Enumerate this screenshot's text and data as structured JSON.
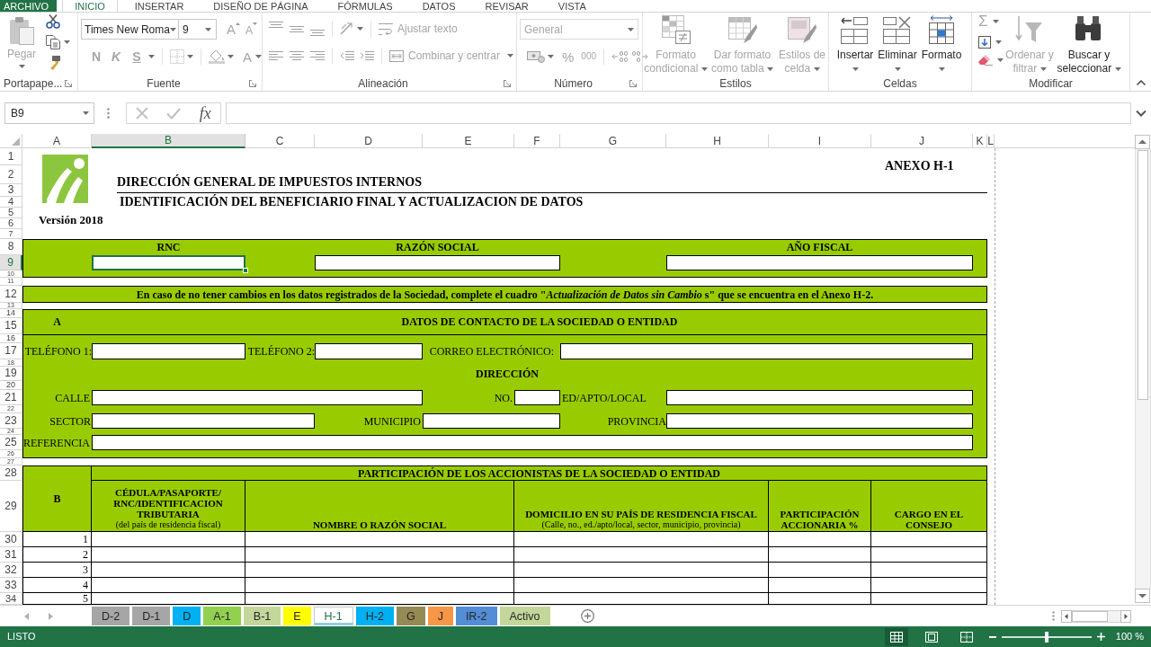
{
  "ribbon_tabs": [
    {
      "label": "ARCHIVO",
      "kind": "file",
      "selected": false
    },
    {
      "label": "INICIO",
      "kind": "tab",
      "selected": true
    },
    {
      "label": "INSERTAR",
      "kind": "tab",
      "selected": false
    },
    {
      "label": "DISEÑO DE PÁGINA",
      "kind": "tab",
      "selected": false
    },
    {
      "label": "FÓRMULAS",
      "kind": "tab",
      "selected": false
    },
    {
      "label": "DATOS",
      "kind": "tab",
      "selected": false
    },
    {
      "label": "REVISAR",
      "kind": "tab",
      "selected": false
    },
    {
      "label": "VISTA",
      "kind": "tab",
      "selected": false
    }
  ],
  "ribbon": {
    "clipboard": {
      "label": "Portapape...",
      "paste": {
        "label": "Pegar",
        "disabled": true
      }
    },
    "font": {
      "label": "Fuente",
      "font_name": "Times New Roma",
      "font_size": "9",
      "grow": {
        "label": "A",
        "disabled": true
      },
      "shrink": {
        "label": "A",
        "disabled": true
      },
      "bold": {
        "label": "N",
        "disabled": true
      },
      "italic": {
        "label": "K",
        "disabled": true
      },
      "underline": {
        "label": "S",
        "disabled": true
      },
      "font_color": {
        "label": "A",
        "disabled": true
      }
    },
    "alignment": {
      "label": "Alineación",
      "wrap_text": {
        "label": "Ajustar texto",
        "disabled": true
      },
      "merge": {
        "label": "Combinar y centrar",
        "disabled": true
      }
    },
    "number": {
      "label": "Número",
      "format": {
        "value": "General",
        "disabled": true
      },
      "percent": {
        "label": "%",
        "disabled": true
      },
      "thousands": {
        "label": "000",
        "disabled": true
      }
    },
    "styles": {
      "label": "Estilos",
      "buttons": [
        {
          "label": "Formato condicional",
          "disabled": true
        },
        {
          "label": "Dar formato como tabla",
          "disabled": true
        },
        {
          "label": "Estilos de celda",
          "disabled": true
        }
      ]
    },
    "cells": {
      "label": "Celdas",
      "buttons": [
        {
          "label": "Insertar",
          "disabled": false
        },
        {
          "label": "Eliminar",
          "disabled": false
        },
        {
          "label": "Formato",
          "disabled": false
        }
      ]
    },
    "editing": {
      "label": "Modificar",
      "autosum": {
        "label": "Σ",
        "disabled": true
      },
      "buttons": [
        {
          "label": "Ordenar y filtrar",
          "disabled": true
        },
        {
          "label": "Buscar y seleccionar",
          "disabled": false
        }
      ]
    }
  },
  "formula_bar": {
    "name_box": "B9",
    "function_label": "fx"
  },
  "sheet": {
    "columns": [
      {
        "label": "A",
        "selected": false
      },
      {
        "label": "B",
        "selected": true
      },
      {
        "label": "C",
        "selected": false
      },
      {
        "label": "D",
        "selected": false
      },
      {
        "label": "E",
        "selected": false
      },
      {
        "label": "F",
        "selected": false
      },
      {
        "label": "G",
        "selected": false
      },
      {
        "label": "H",
        "selected": false
      },
      {
        "label": "I",
        "selected": false
      },
      {
        "label": "J",
        "selected": false
      },
      {
        "label": "K",
        "selected": false
      },
      {
        "label": "L",
        "selected": false
      }
    ],
    "rows": [
      {
        "label": "1",
        "selected": false
      },
      {
        "label": "2",
        "selected": false
      },
      {
        "label": "3",
        "selected": false
      },
      {
        "label": "4",
        "selected": false
      },
      {
        "label": "5",
        "selected": false
      },
      {
        "label": "6",
        "selected": false
      },
      {
        "label": "7",
        "selected": false
      },
      {
        "label": "8",
        "selected": false
      },
      {
        "label": "9",
        "selected": true
      },
      {
        "label": "10",
        "selected": false
      },
      {
        "label": "11",
        "selected": false
      },
      {
        "label": "12",
        "selected": false
      },
      {
        "label": "13",
        "selected": false
      },
      {
        "label": "14",
        "selected": false
      },
      {
        "label": "15",
        "selected": false
      },
      {
        "label": "16",
        "selected": false
      },
      {
        "label": "17",
        "selected": false
      },
      {
        "label": "18",
        "selected": false
      },
      {
        "label": "19",
        "selected": false
      },
      {
        "label": "20",
        "selected": false
      },
      {
        "label": "21",
        "selected": false
      },
      {
        "label": "22",
        "selected": false
      },
      {
        "label": "23",
        "selected": false
      },
      {
        "label": "24",
        "selected": false
      },
      {
        "label": "25",
        "selected": false
      },
      {
        "label": "26",
        "selected": false
      },
      {
        "label": "27",
        "selected": false
      },
      {
        "label": "28",
        "selected": false
      },
      {
        "label": "29",
        "selected": false
      },
      {
        "label": "30",
        "selected": false
      },
      {
        "label": "31",
        "selected": false
      },
      {
        "label": "32",
        "selected": false
      },
      {
        "label": "33",
        "selected": false
      },
      {
        "label": "34",
        "selected": false
      }
    ],
    "annex": "ANEXO H-1",
    "title": "DIRECCIÓN GENERAL DE IMPUESTOS INTERNOS",
    "subtitle": "IDENTIFICACIÓN DEL BENEFICIARIO FINAL Y ACTUALIZACION DE DATOS",
    "version": "Versión 2018",
    "header_fields": [
      {
        "label": "RNC",
        "selected": true
      },
      {
        "label": "RAZÓN SOCIAL",
        "selected": false
      },
      {
        "label": "AÑO FISCAL",
        "selected": false
      }
    ],
    "notice": "En caso de no tener cambios en los datos registrados de la Sociedad, complete el cuadro \"*Actualización de Datos sin Cambio* s\" que se encuentra en el Anexo H-2.",
    "contact": {
      "letter": "A",
      "title": "DATOS DE CONTACTO DE LA SOCIEDAD O ENTIDAD",
      "address_title": "DIRECCIÓN",
      "fields": [
        "TELÉFONO 1:",
        "TELÉFONO 2:",
        "CORREO ELECTRÓNICO:",
        "CALLE",
        "NO.",
        "ED/APTO/LOCAL",
        "SECTOR",
        "MUNICIPIO",
        "PROVINCIA",
        "REFERENCIA"
      ]
    },
    "shareholders": {
      "letter": "B",
      "title": "PARTICIPACIÓN DE LOS ACCIONISTAS DE LA SOCIEDAD O ENTIDAD",
      "columns": [
        {
          "label": "CÉDULA/PASAPORTE/ RNC/IDENTIFICACION TRIBUTARIA",
          "note": "(del país de residencia fiscal)"
        },
        {
          "label": "NOMBRE O RAZÓN SOCIAL"
        },
        {
          "label": "DOMICILIO EN SU PAÍS DE RESIDENCIA FISCAL",
          "note": "(Calle, no., ed./apto/local, sector, municipio, provincia)"
        },
        {
          "label": "PARTICIPACIÓN ACCIONARIA %"
        },
        {
          "label": "CARGO EN EL CONSEJO"
        }
      ],
      "rows": [
        "1",
        "2",
        "3",
        "4",
        "5"
      ]
    }
  },
  "sheet_tabs": [
    {
      "label": "D-2",
      "color": "#a6a6a6",
      "selected": false
    },
    {
      "label": "D-1",
      "color": "#a6a6a6",
      "selected": false
    },
    {
      "label": "D",
      "color": "#00b0f0",
      "selected": false
    },
    {
      "label": "A-1",
      "color": "#92d050",
      "selected": false
    },
    {
      "label": "B-1",
      "color": "#c4d79b",
      "selected": false
    },
    {
      "label": "E",
      "color": "#ffff00",
      "selected": false
    },
    {
      "label": "H-1",
      "color": "#92cddc",
      "selected": true
    },
    {
      "label": "H-2",
      "color": "#00b0f0",
      "selected": false
    },
    {
      "label": "G",
      "color": "#948a54",
      "selected": false
    },
    {
      "label": "J",
      "color": "#f79646",
      "selected": false
    },
    {
      "label": "IR-2",
      "color": "#538dd5",
      "selected": false
    },
    {
      "label": "Activo",
      "color": "#c4d79b",
      "selected": false
    }
  ],
  "status_bar": {
    "text": "LISTO",
    "views": [
      {
        "kind": "normal",
        "selected": true
      },
      {
        "kind": "page_layout",
        "selected": false
      },
      {
        "kind": "page_break",
        "selected": false
      }
    ],
    "zoom": {
      "level": 0.5,
      "reading": "100 %"
    }
  }
}
